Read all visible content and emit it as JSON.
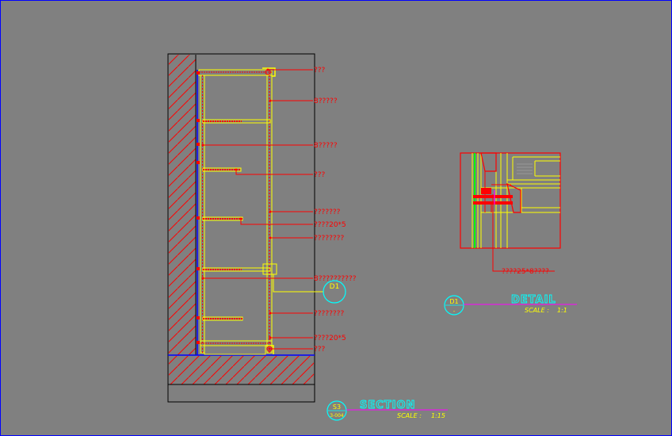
{
  "section_callouts": [
    {
      "label": "???"
    },
    {
      "label": "8?????"
    },
    {
      "label": "8?????"
    },
    {
      "label": "???"
    },
    {
      "label": "???????"
    },
    {
      "label": "????20*5"
    },
    {
      "label": "????????"
    },
    {
      "label": "8??????????"
    },
    {
      "label": "????????"
    },
    {
      "label": "????20*5"
    },
    {
      "label": "???"
    }
  ],
  "detail_callout": {
    "label": "????25*8????"
  },
  "detail_marker_on_section": {
    "id": "D1"
  },
  "detail_title": {
    "marker_id": "D1",
    "marker_sub": "-",
    "title": "DETAIL",
    "scale_label": "SCALE :",
    "scale_value": "1:1"
  },
  "section_title": {
    "marker_id": "S3",
    "marker_sub": "3-004",
    "title": "SECTION",
    "scale_label": "SCALE :",
    "scale_value": "1:15"
  },
  "colors": {
    "background": "#808080",
    "leader": "#ff0000",
    "frame": "#000000",
    "wall": "#0000ff",
    "panel": "#ffff00",
    "title": "#00ffff",
    "underline": "#ff00ff",
    "green": "#00ff00"
  }
}
